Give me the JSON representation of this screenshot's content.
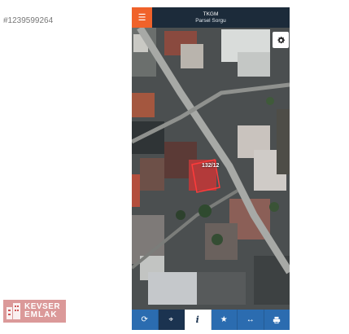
{
  "listing_id": "#1239599264",
  "watermark": {
    "line1": "KEVSER",
    "line2": "EMLAK"
  },
  "app": {
    "title": "TKGM",
    "subtitle": "Parsel Sorgu",
    "accent_color": "#f0622a",
    "header_color": "#1c2b3a",
    "toolbar_color": "#2b6cb0"
  },
  "map": {
    "view": "satellite",
    "parcel_label": "132/12"
  },
  "toolbar": {
    "buttons": [
      {
        "icon": "refresh-icon",
        "active": false
      },
      {
        "icon": "locate-icon",
        "active": false
      },
      {
        "icon": "info-icon",
        "active": true
      },
      {
        "icon": "star-icon",
        "active": false
      },
      {
        "icon": "measure-icon",
        "active": false
      },
      {
        "icon": "print-icon",
        "active": false
      }
    ]
  }
}
